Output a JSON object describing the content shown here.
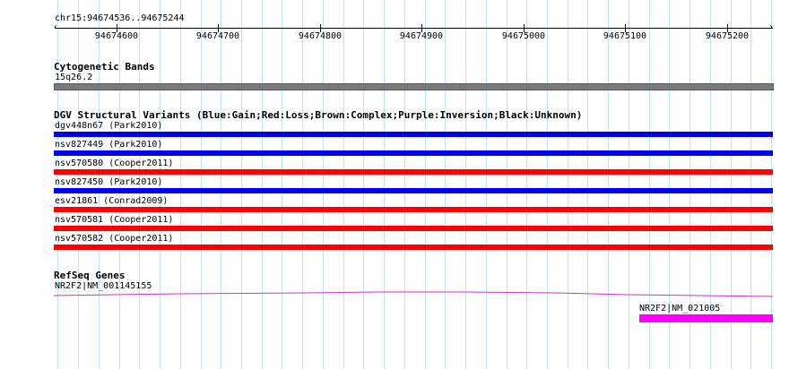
{
  "location": "chr15:94674536..94675244",
  "ruler": {
    "ticks": [
      "94674600",
      "94674700",
      "94674800",
      "94674900",
      "94675000",
      "94675100",
      "94675200"
    ]
  },
  "cytoband": {
    "title": "Cytogenetic Bands",
    "band": "15q26.2"
  },
  "dgv": {
    "title": "DGV Structural Variants (Blue:Gain;Red:Loss;Brown:Complex;Purple:Inversion;Black:Unknown)",
    "features": [
      {
        "label": "dgv448n67 (Park2010)",
        "color": "#0000ee"
      },
      {
        "label": "nsv827449 (Park2010)",
        "color": "#0000ee"
      },
      {
        "label": "nsv570580 (Cooper2011)",
        "color": "#ff0000"
      },
      {
        "label": "nsv827450 (Park2010)",
        "color": "#0000ee"
      },
      {
        "label": "esv21861 (Conrad2009)",
        "color": "#ff0000"
      },
      {
        "label": "nsv570581 (Cooper2011)",
        "color": "#ff0000"
      },
      {
        "label": "nsv570582 (Cooper2011)",
        "color": "#ff0000"
      }
    ]
  },
  "refseq": {
    "title": "RefSeq Genes",
    "genes": [
      {
        "label": "NR2F2|NM_001145155",
        "color": "#cc33cc"
      },
      {
        "label": "NR2F2|NM_021005",
        "color": "#ff00ff"
      }
    ]
  }
}
